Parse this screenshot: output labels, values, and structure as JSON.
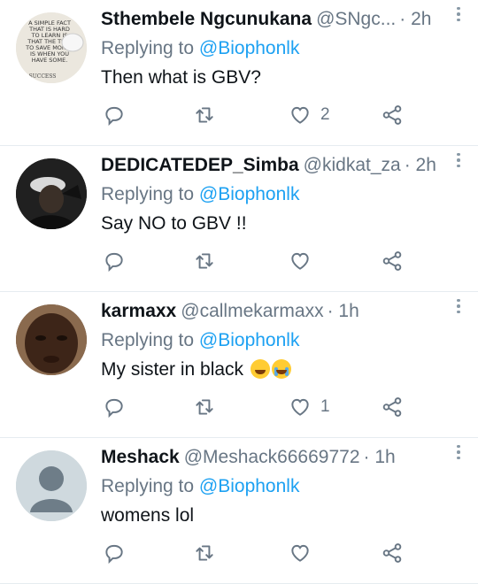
{
  "tweets": [
    {
      "name": "Sthembele Ngcunukana",
      "handle": "@SNgc...",
      "time": "· 2h",
      "reply_prefix": "Replying to ",
      "mention": "@Biophonlk",
      "text": "Then what is GBV?",
      "avatar": "poster-avatar",
      "avatar_text": [
        "A SIMPLE FACT",
        "THAT IS HARD",
        "TO LEARN IS",
        "THAT THE TIME",
        "TO SAVE MONEY",
        "IS WHEN YOU",
        "HAVE SOME.",
        "SUCCESS"
      ],
      "actions": {
        "reply": "",
        "retweet": "",
        "like": "2",
        "share": ""
      }
    },
    {
      "name": "DEDICATEDEP_Simba",
      "handle": "@kidkat_za",
      "time": "· 2h",
      "reply_prefix": "Replying to ",
      "mention": "@Biophonlk",
      "text": "Say NO to GBV !!",
      "avatar": "dark-photo-avatar",
      "actions": {
        "reply": "",
        "retweet": "",
        "like": "",
        "share": ""
      }
    },
    {
      "name": "karmaxx",
      "handle": "@callmekarmaxx",
      "time": "· 1h",
      "reply_prefix": "Replying to ",
      "mention": "@Biophonlk",
      "text": "My sister in black ",
      "emojis": [
        "face-with-tears-of-joy",
        "loudly-crying-face"
      ],
      "avatar": "face-photo-avatar",
      "actions": {
        "reply": "",
        "retweet": "",
        "like": "1",
        "share": ""
      }
    },
    {
      "name": "Meshack",
      "handle": "@Meshack66669772",
      "time": "· 1h",
      "reply_prefix": "Replying to ",
      "mention": "@Biophonlk",
      "text": "womens lol",
      "avatar": "default-avatar",
      "actions": {
        "reply": "",
        "retweet": "",
        "like": "",
        "share": ""
      }
    }
  ],
  "colors": {
    "accent": "#1da1f2",
    "secondary_text": "#687684",
    "divider": "#e6ecf0"
  }
}
